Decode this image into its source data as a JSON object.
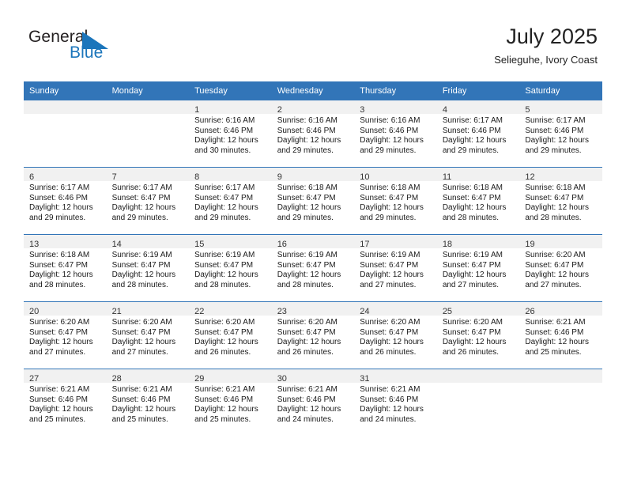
{
  "brand": {
    "name_top": "General",
    "name_bottom": "Blue",
    "accent_color": "#1b75bb"
  },
  "header": {
    "title": "July 2025",
    "subtitle": "Selieguhe, Ivory Coast"
  },
  "theme": {
    "header_bg": "#3275b8",
    "daynum_bg": "#f1f1f1",
    "grid_line": "#3275b8"
  },
  "weekday_headers": [
    "Sunday",
    "Monday",
    "Tuesday",
    "Wednesday",
    "Thursday",
    "Friday",
    "Saturday"
  ],
  "weeks": [
    [
      {
        "day": "",
        "sunrise": "",
        "sunset": "",
        "daylight1": "",
        "daylight2": ""
      },
      {
        "day": "",
        "sunrise": "",
        "sunset": "",
        "daylight1": "",
        "daylight2": ""
      },
      {
        "day": "1",
        "sunrise": "Sunrise: 6:16 AM",
        "sunset": "Sunset: 6:46 PM",
        "daylight1": "Daylight: 12 hours",
        "daylight2": "and 30 minutes."
      },
      {
        "day": "2",
        "sunrise": "Sunrise: 6:16 AM",
        "sunset": "Sunset: 6:46 PM",
        "daylight1": "Daylight: 12 hours",
        "daylight2": "and 29 minutes."
      },
      {
        "day": "3",
        "sunrise": "Sunrise: 6:16 AM",
        "sunset": "Sunset: 6:46 PM",
        "daylight1": "Daylight: 12 hours",
        "daylight2": "and 29 minutes."
      },
      {
        "day": "4",
        "sunrise": "Sunrise: 6:17 AM",
        "sunset": "Sunset: 6:46 PM",
        "daylight1": "Daylight: 12 hours",
        "daylight2": "and 29 minutes."
      },
      {
        "day": "5",
        "sunrise": "Sunrise: 6:17 AM",
        "sunset": "Sunset: 6:46 PM",
        "daylight1": "Daylight: 12 hours",
        "daylight2": "and 29 minutes."
      }
    ],
    [
      {
        "day": "6",
        "sunrise": "Sunrise: 6:17 AM",
        "sunset": "Sunset: 6:46 PM",
        "daylight1": "Daylight: 12 hours",
        "daylight2": "and 29 minutes."
      },
      {
        "day": "7",
        "sunrise": "Sunrise: 6:17 AM",
        "sunset": "Sunset: 6:47 PM",
        "daylight1": "Daylight: 12 hours",
        "daylight2": "and 29 minutes."
      },
      {
        "day": "8",
        "sunrise": "Sunrise: 6:17 AM",
        "sunset": "Sunset: 6:47 PM",
        "daylight1": "Daylight: 12 hours",
        "daylight2": "and 29 minutes."
      },
      {
        "day": "9",
        "sunrise": "Sunrise: 6:18 AM",
        "sunset": "Sunset: 6:47 PM",
        "daylight1": "Daylight: 12 hours",
        "daylight2": "and 29 minutes."
      },
      {
        "day": "10",
        "sunrise": "Sunrise: 6:18 AM",
        "sunset": "Sunset: 6:47 PM",
        "daylight1": "Daylight: 12 hours",
        "daylight2": "and 29 minutes."
      },
      {
        "day": "11",
        "sunrise": "Sunrise: 6:18 AM",
        "sunset": "Sunset: 6:47 PM",
        "daylight1": "Daylight: 12 hours",
        "daylight2": "and 28 minutes."
      },
      {
        "day": "12",
        "sunrise": "Sunrise: 6:18 AM",
        "sunset": "Sunset: 6:47 PM",
        "daylight1": "Daylight: 12 hours",
        "daylight2": "and 28 minutes."
      }
    ],
    [
      {
        "day": "13",
        "sunrise": "Sunrise: 6:18 AM",
        "sunset": "Sunset: 6:47 PM",
        "daylight1": "Daylight: 12 hours",
        "daylight2": "and 28 minutes."
      },
      {
        "day": "14",
        "sunrise": "Sunrise: 6:19 AM",
        "sunset": "Sunset: 6:47 PM",
        "daylight1": "Daylight: 12 hours",
        "daylight2": "and 28 minutes."
      },
      {
        "day": "15",
        "sunrise": "Sunrise: 6:19 AM",
        "sunset": "Sunset: 6:47 PM",
        "daylight1": "Daylight: 12 hours",
        "daylight2": "and 28 minutes."
      },
      {
        "day": "16",
        "sunrise": "Sunrise: 6:19 AM",
        "sunset": "Sunset: 6:47 PM",
        "daylight1": "Daylight: 12 hours",
        "daylight2": "and 28 minutes."
      },
      {
        "day": "17",
        "sunrise": "Sunrise: 6:19 AM",
        "sunset": "Sunset: 6:47 PM",
        "daylight1": "Daylight: 12 hours",
        "daylight2": "and 27 minutes."
      },
      {
        "day": "18",
        "sunrise": "Sunrise: 6:19 AM",
        "sunset": "Sunset: 6:47 PM",
        "daylight1": "Daylight: 12 hours",
        "daylight2": "and 27 minutes."
      },
      {
        "day": "19",
        "sunrise": "Sunrise: 6:20 AM",
        "sunset": "Sunset: 6:47 PM",
        "daylight1": "Daylight: 12 hours",
        "daylight2": "and 27 minutes."
      }
    ],
    [
      {
        "day": "20",
        "sunrise": "Sunrise: 6:20 AM",
        "sunset": "Sunset: 6:47 PM",
        "daylight1": "Daylight: 12 hours",
        "daylight2": "and 27 minutes."
      },
      {
        "day": "21",
        "sunrise": "Sunrise: 6:20 AM",
        "sunset": "Sunset: 6:47 PM",
        "daylight1": "Daylight: 12 hours",
        "daylight2": "and 27 minutes."
      },
      {
        "day": "22",
        "sunrise": "Sunrise: 6:20 AM",
        "sunset": "Sunset: 6:47 PM",
        "daylight1": "Daylight: 12 hours",
        "daylight2": "and 26 minutes."
      },
      {
        "day": "23",
        "sunrise": "Sunrise: 6:20 AM",
        "sunset": "Sunset: 6:47 PM",
        "daylight1": "Daylight: 12 hours",
        "daylight2": "and 26 minutes."
      },
      {
        "day": "24",
        "sunrise": "Sunrise: 6:20 AM",
        "sunset": "Sunset: 6:47 PM",
        "daylight1": "Daylight: 12 hours",
        "daylight2": "and 26 minutes."
      },
      {
        "day": "25",
        "sunrise": "Sunrise: 6:20 AM",
        "sunset": "Sunset: 6:47 PM",
        "daylight1": "Daylight: 12 hours",
        "daylight2": "and 26 minutes."
      },
      {
        "day": "26",
        "sunrise": "Sunrise: 6:21 AM",
        "sunset": "Sunset: 6:46 PM",
        "daylight1": "Daylight: 12 hours",
        "daylight2": "and 25 minutes."
      }
    ],
    [
      {
        "day": "27",
        "sunrise": "Sunrise: 6:21 AM",
        "sunset": "Sunset: 6:46 PM",
        "daylight1": "Daylight: 12 hours",
        "daylight2": "and 25 minutes."
      },
      {
        "day": "28",
        "sunrise": "Sunrise: 6:21 AM",
        "sunset": "Sunset: 6:46 PM",
        "daylight1": "Daylight: 12 hours",
        "daylight2": "and 25 minutes."
      },
      {
        "day": "29",
        "sunrise": "Sunrise: 6:21 AM",
        "sunset": "Sunset: 6:46 PM",
        "daylight1": "Daylight: 12 hours",
        "daylight2": "and 25 minutes."
      },
      {
        "day": "30",
        "sunrise": "Sunrise: 6:21 AM",
        "sunset": "Sunset: 6:46 PM",
        "daylight1": "Daylight: 12 hours",
        "daylight2": "and 24 minutes."
      },
      {
        "day": "31",
        "sunrise": "Sunrise: 6:21 AM",
        "sunset": "Sunset: 6:46 PM",
        "daylight1": "Daylight: 12 hours",
        "daylight2": "and 24 minutes."
      },
      {
        "day": "",
        "sunrise": "",
        "sunset": "",
        "daylight1": "",
        "daylight2": ""
      },
      {
        "day": "",
        "sunrise": "",
        "sunset": "",
        "daylight1": "",
        "daylight2": ""
      }
    ]
  ]
}
